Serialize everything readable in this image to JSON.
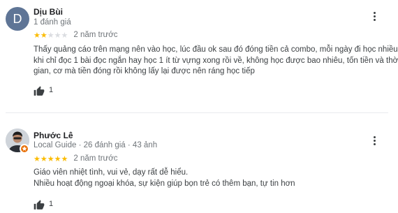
{
  "reviews": [
    {
      "avatar_letter": "D",
      "name": "Dịu Bùi",
      "meta": "1 đánh giá",
      "rating": 2,
      "rating_max": 5,
      "date": "2 năm trước",
      "text_lines": [
        "Thấy quảng cáo trên mạng nên vào học, lúc đầu ok sau đó đóng tiền cả combo, mỗi ngày đi học nhiều",
        "khi chỉ đọc 1 bài đọc ngắn hay học 1 ít từ vựng xong rồi về, không học được bao nhiêu, tốn tiền và thời",
        "gian, cơ mà tiền đóng rồi không lấy lại được nên ráng học tiếp"
      ],
      "likes": "1",
      "colors": {
        "avatar_bg": "#5f7596"
      }
    },
    {
      "name": "Phước Lê",
      "meta": "Local Guide · 26 đánh giá · 43 ảnh",
      "rating": 5,
      "rating_max": 5,
      "date": "2 năm trước",
      "text_lines": [
        "Giáo viên nhiệt tình, vui vẻ, dạy rất dễ hiểu.",
        "Nhiều hoạt động ngoại khóa, sự kiện giúp bọn trẻ có thêm bạn, tự tin hơn"
      ],
      "likes": "1",
      "colors": {
        "badge": "#e8710a"
      }
    }
  ],
  "icons": {
    "like": "thumbs-up-icon",
    "more": "more-vert-icon",
    "guide": "local-guide-star-icon"
  },
  "colors": {
    "star_filled": "#fbbc04",
    "star_empty": "#dadce0",
    "text_secondary": "#70757a"
  }
}
